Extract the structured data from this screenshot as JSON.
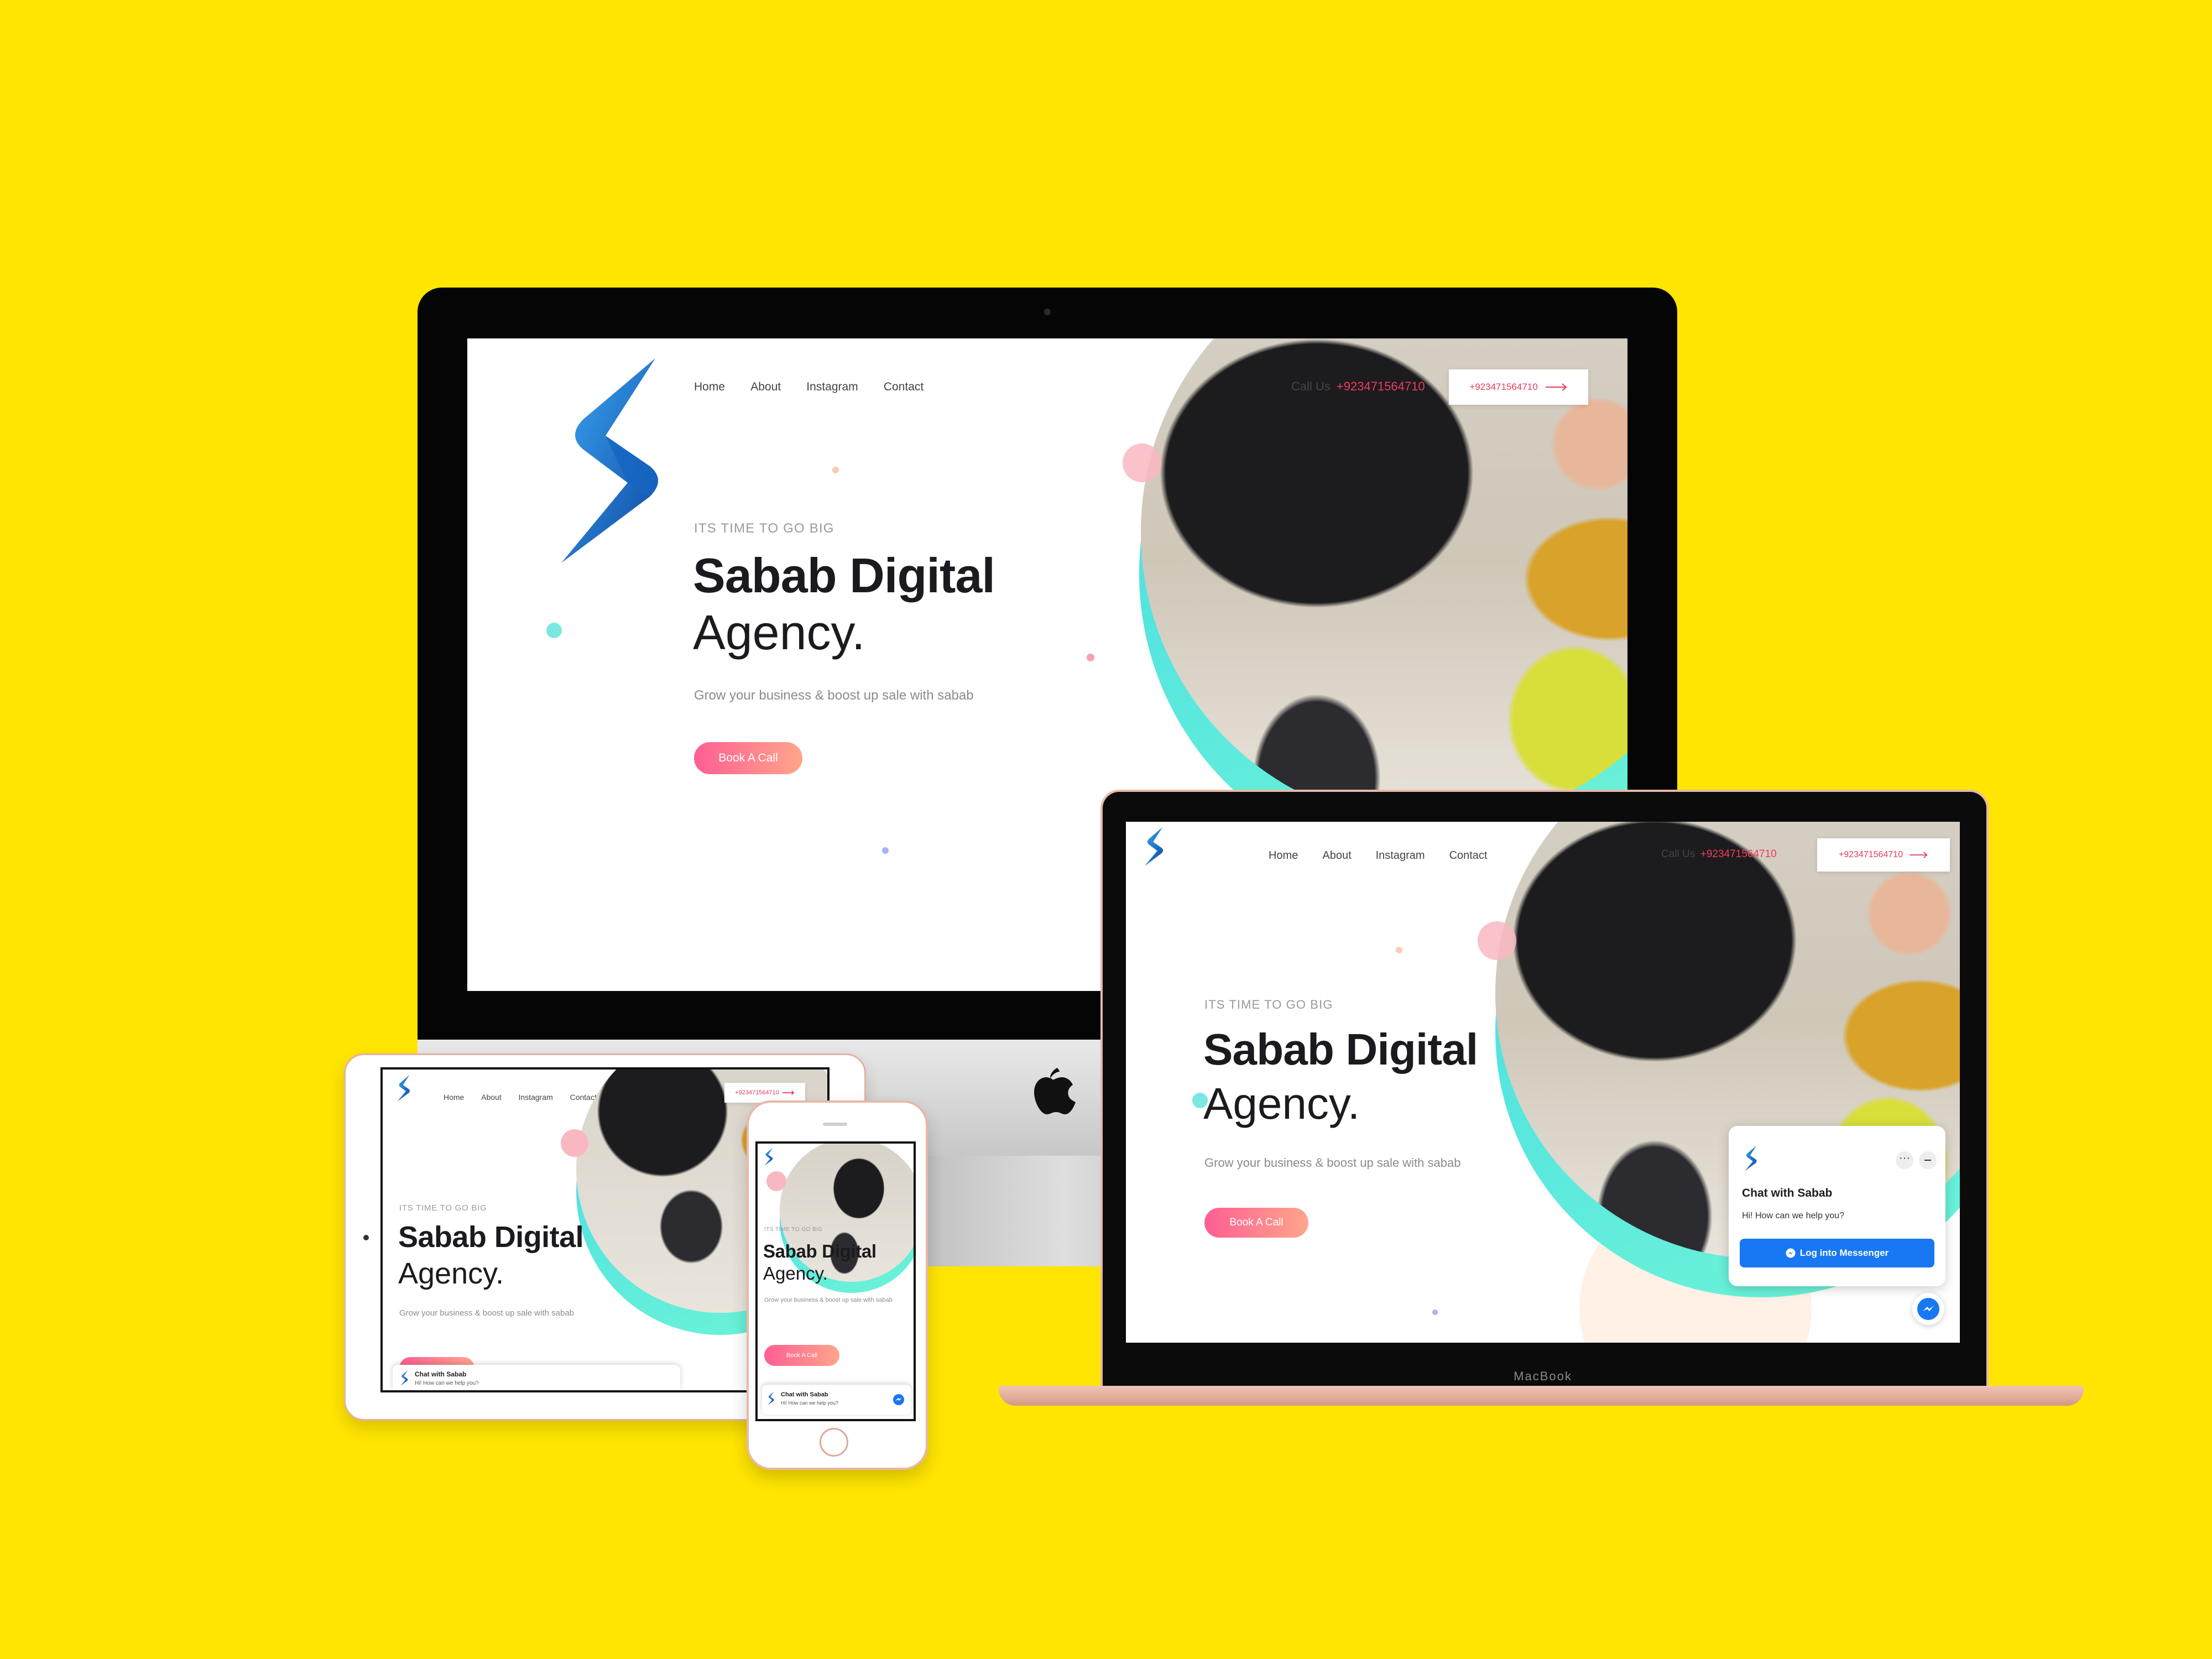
{
  "site": {
    "nav": [
      "Home",
      "About",
      "Instagram",
      "Contact"
    ],
    "eyebrow": "ITS TIME TO GO BIG",
    "headline_bold": "Sabab Digital",
    "headline_light": "Agency.",
    "subtitle": "Grow your business & boost up sale with sabab",
    "cta_label": "Book A Call",
    "call_us_label": "Call Us",
    "phone": "+923471564710"
  },
  "chat": {
    "title": "Chat with Sabab",
    "message": "Hi! How can we help you?",
    "button_label": "Log into Messenger"
  },
  "devices": {
    "laptop_label": "MacBook"
  },
  "colors": {
    "background": "#FFE500",
    "accent_pink": "#F03B5D",
    "cta_gradient_start": "#FF5E93",
    "cta_gradient_end": "#FFA58B",
    "teal": "#4FE3D8",
    "messenger_blue": "#1877F2",
    "logo_blue": "#1E88E5"
  },
  "icons": {
    "logo": "lightning-bolt-logo",
    "arrow": "arrow-right-icon",
    "messenger": "messenger-icon",
    "apple": "apple-logo-icon"
  }
}
